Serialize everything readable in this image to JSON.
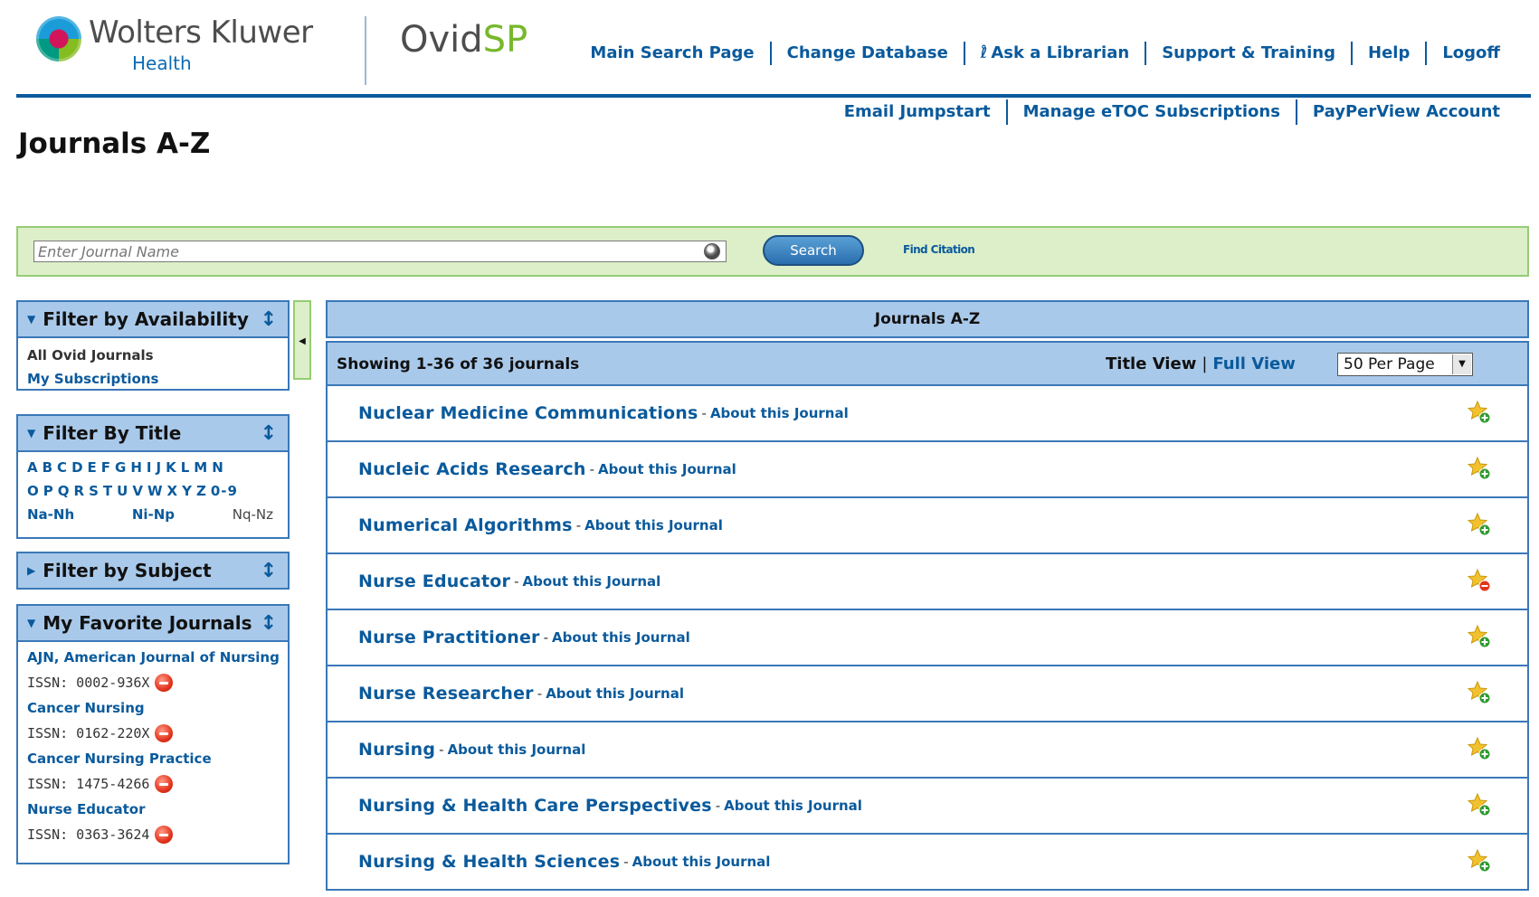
{
  "brand": {
    "company": "Wolters Kluwer",
    "division": "Health",
    "product_part1": "Ovid",
    "product_part2": "SP"
  },
  "top_nav": [
    "Main Search Page",
    "Change Database",
    "Ask a Librarian",
    "Support & Training",
    "Help",
    "Logoff"
  ],
  "sub_nav": [
    "Email Jumpstart",
    "Manage eTOC Subscriptions",
    "PayPerView Account"
  ],
  "page_title": "Journals A-Z",
  "search": {
    "placeholder": "Enter Journal Name",
    "button_label": "Search",
    "find_citation_label": "Find Citation"
  },
  "filters": {
    "availability": {
      "title": "Filter by Availability",
      "items": [
        "All Ovid Journals",
        "My Subscriptions"
      ]
    },
    "by_title": {
      "title": "Filter By Title",
      "letters_row1": [
        "A",
        "B",
        "C",
        "D",
        "E",
        "F",
        "G",
        "H",
        "I",
        "J",
        "K",
        "L",
        "M",
        "N"
      ],
      "letters_row2": [
        "O",
        "P",
        "Q",
        "R",
        "S",
        "T",
        "U",
        "V",
        "W",
        "X",
        "Y",
        "Z",
        "0-9"
      ],
      "ranges": [
        "Na-Nh",
        "Ni-Np",
        "Nq-Nz"
      ]
    },
    "by_subject": {
      "title": "Filter by Subject"
    }
  },
  "favorites": {
    "title": "My Favorite Journals",
    "items": [
      {
        "name": "AJN, American Journal of Nursing",
        "issn": "ISSN: 0002-936X"
      },
      {
        "name": "Cancer Nursing",
        "issn": "ISSN: 0162-220X"
      },
      {
        "name": "Cancer Nursing Practice",
        "issn": "ISSN: 1475-4266"
      },
      {
        "name": "Nurse Educator",
        "issn": "ISSN: 0363-3624"
      }
    ]
  },
  "results": {
    "header": "Journals A-Z",
    "showing": "Showing 1-36 of 36 journals",
    "title_view": "Title View",
    "full_view": "Full View",
    "view_separator": "|",
    "per_page": "50  Per Page",
    "about_label": "About this Journal",
    "journals": [
      {
        "title": "Nuclear Medicine Communications",
        "favorite": false
      },
      {
        "title": "Nucleic Acids Research",
        "favorite": false
      },
      {
        "title": "Numerical Algorithms",
        "favorite": false
      },
      {
        "title": "Nurse Educator",
        "favorite": true
      },
      {
        "title": "Nurse Practitioner",
        "favorite": false
      },
      {
        "title": "Nurse Researcher",
        "favorite": false
      },
      {
        "title": "Nursing",
        "favorite": false
      },
      {
        "title": "Nursing & Health Care Perspectives",
        "favorite": false
      },
      {
        "title": "Nursing & Health Sciences",
        "favorite": false
      }
    ]
  },
  "colors": {
    "link": "#0a5a9c",
    "panel_fill": "#a9c9ea",
    "panel_border": "#3a78b8",
    "search_bar_fill": "#dcefc9",
    "star": "#f2c12e",
    "add_badge": "#2e9a2e",
    "remove_badge": "#e3341c"
  }
}
